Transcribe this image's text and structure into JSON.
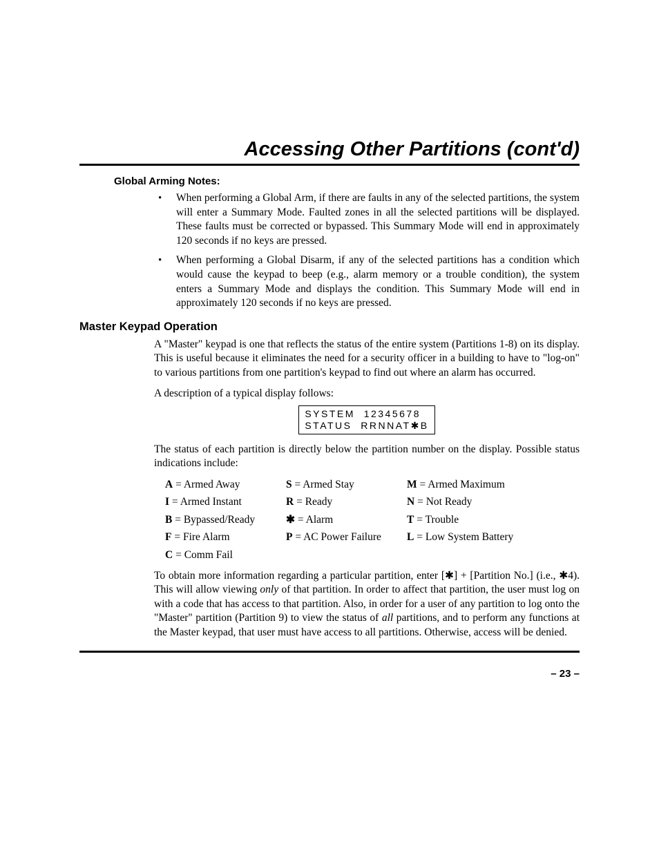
{
  "heading": "Accessing Other Partitions (cont'd)",
  "globalArming": {
    "title": "Global Arming Notes:",
    "bullets": [
      "When performing a Global Arm, if there are faults in any of the selected partitions, the system will enter a Summary Mode. Faulted zones in all the selected partitions will be displayed. These faults must be corrected or bypassed. This Summary Mode will end in approximately 120 seconds if no keys are pressed.",
      "When performing a Global Disarm, if any of the selected partitions has a condition which would cause the keypad to beep (e.g., alarm memory or a trouble condition), the system enters a Summary Mode and displays the condition. This Summary Mode will end in approximately 120 seconds if no keys are pressed."
    ]
  },
  "master": {
    "title": "Master Keypad Operation",
    "para1": "A \"Master\" keypad is one that reflects the status of the entire system (Partitions 1-8) on its display.  This is useful because it eliminates the need for a security officer in a building to have to \"log-on\" to various partitions from one partition's keypad to find out where an alarm has occurred.",
    "para2": "A description of a typical display follows:",
    "displayLine1": "SYSTEM  12345678",
    "displayLine2": "STATUS  RRNNAT✱B",
    "para3": "The status of each partition is directly below the partition number on the display. Possible status indications include:",
    "statuses": [
      {
        "k": "A",
        "v": "Armed Away"
      },
      {
        "k": "S",
        "v": "Armed Stay"
      },
      {
        "k": "M",
        "v": "Armed Maximum"
      },
      {
        "k": "I",
        "v": "Armed Instant"
      },
      {
        "k": "R",
        "v": "Ready"
      },
      {
        "k": "N",
        "v": "Not Ready"
      },
      {
        "k": "B",
        "v": "Bypassed/Ready"
      },
      {
        "k": "✱",
        "v": "Alarm"
      },
      {
        "k": "T",
        "v": "Trouble"
      },
      {
        "k": "F",
        "v": "Fire Alarm"
      },
      {
        "k": "P",
        "v": "AC Power Failure"
      },
      {
        "k": "L",
        "v": "Low System Battery"
      },
      {
        "k": "C",
        "v": "Comm Fail"
      }
    ],
    "para4_pre": "To obtain more information regarding a particular partition, enter [✱] + [Partition No.] (i.e., ✱4).  This will allow viewing ",
    "para4_only": "only",
    "para4_mid": " of that partition.  In order to affect that partition, the user must log on with a code that has access to that partition.  Also, in order for a user of any partition to log onto the \"Master\" partition (Partition 9) to view the status of ",
    "para4_all": "all",
    "para4_post": " partitions, and to perform any functions at the Master keypad, that user must have access to all partitions.  Otherwise, access will be denied."
  },
  "pageNumber": "– 23 –"
}
